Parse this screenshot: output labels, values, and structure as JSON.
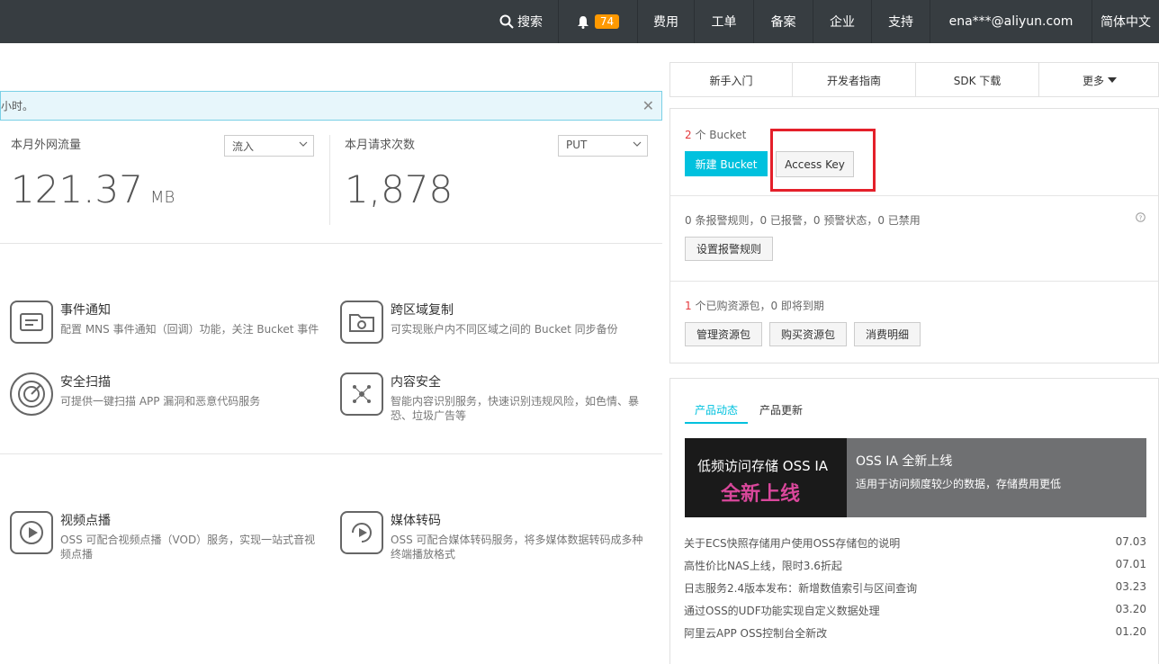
{
  "topbar": {
    "search": "搜索",
    "notifications_count": "74",
    "fees": "费用",
    "tickets": "工单",
    "icp": "备案",
    "enterprise": "企业",
    "support": "支持",
    "account": "ena***@aliyun.com",
    "language": "简体中文"
  },
  "notice": {
    "text": "小时。"
  },
  "stats": {
    "traffic_label": "本月外网流量",
    "traffic_select": "流入",
    "traffic_value": "121.37",
    "traffic_unit": "MB",
    "requests_label": "本月请求次数",
    "requests_select": "PUT",
    "requests_value": "1,878"
  },
  "features": [
    {
      "title": "事件通知",
      "desc": "配置 MNS 事件通知（回调）功能，关注 Bucket 事件",
      "icon": "event-notification-icon"
    },
    {
      "title": "跨区域复制",
      "desc": "可实现账户内不同区域之间的 Bucket 同步备份",
      "icon": "cross-region-replication-icon"
    },
    {
      "title": "安全扫描",
      "desc": "可提供一键扫描 APP 漏洞和恶意代码服务",
      "icon": "security-scan-icon"
    },
    {
      "title": "内容安全",
      "desc": "智能内容识别服务，快速识别违规风险，如色情、暴恐、垃圾广告等",
      "icon": "content-security-icon"
    },
    {
      "title": "视频点播",
      "desc": "OSS 可配合视频点播（VOD）服务，实现一站式音视频点播",
      "icon": "video-on-demand-icon"
    },
    {
      "title": "媒体转码",
      "desc": "OSS 可配合媒体转码服务，将多媒体数据转码成多种终端播放格式",
      "icon": "media-transcode-icon"
    }
  ],
  "right_tabs": {
    "getting_started": "新手入门",
    "dev_guide": "开发者指南",
    "sdk_download": "SDK 下载",
    "more": "更多"
  },
  "bucket": {
    "count": "2",
    "count_suffix": "个 Bucket",
    "new_bucket": "新建 Bucket",
    "access_key": "Access Key"
  },
  "alarms": {
    "summary": "0 条报警规则，0 已报警，0 预警状态，0 已禁用",
    "set_rules": "设置报警规则"
  },
  "packages": {
    "count": "1",
    "summary_suffix": "个已购资源包，0 即将到期",
    "manage": "管理资源包",
    "buy": "购买资源包",
    "details": "消费明细"
  },
  "news": {
    "tab_active": "产品动态",
    "tab_updates": "产品更新",
    "banner_left_line1": "低频访问存储 OSS IA",
    "banner_left_line2": "全新上线",
    "banner_title": "OSS IA 全新上线",
    "banner_sub": "适用于访问频度较少的数据，存储费用更低",
    "items": [
      {
        "title": "关于ECS快照存储用户使用OSS存储包的说明",
        "date": "07.03"
      },
      {
        "title": "高性价比NAS上线，限时3.6折起",
        "date": "07.01"
      },
      {
        "title": "日志服务2.4版本发布：新增数值索引与区间查询",
        "date": "03.23"
      },
      {
        "title": "通过OSS的UDF功能实现自定义数据处理",
        "date": "03.20"
      },
      {
        "title": "阿里云APP OSS控制台全新改",
        "date": "01.20"
      }
    ]
  },
  "colors": {
    "topbar": "#373d41",
    "accent": "#00c1de",
    "badge": "#ff9900",
    "highlight_box": "#e4202a"
  }
}
